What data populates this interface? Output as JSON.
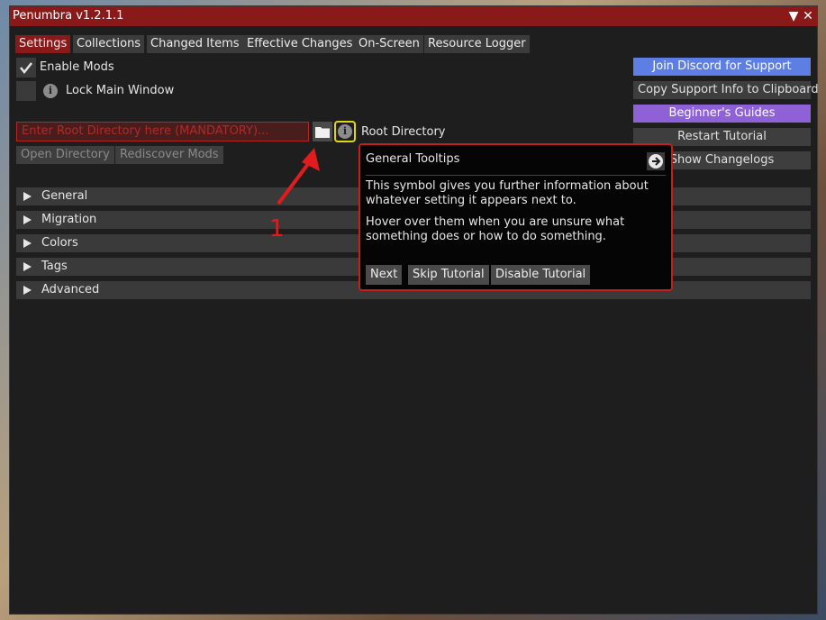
{
  "window": {
    "title": "Penumbra v1.2.1.1",
    "collapse_icon": "triangle-down-icon",
    "close_icon": "close-icon"
  },
  "tabs": [
    {
      "label": "Settings",
      "active": true
    },
    {
      "label": "Collections"
    },
    {
      "label": "Changed Items"
    },
    {
      "label": "Effective Changes"
    },
    {
      "label": "On-Screen"
    },
    {
      "label": "Resource Logger"
    }
  ],
  "settings": {
    "enable_mods": {
      "label": "Enable Mods",
      "checked": true
    },
    "lock_main_window": {
      "label": "Lock Main Window",
      "checked": false
    },
    "root_directory": {
      "placeholder": "Enter Root Directory here (MANDATORY)...",
      "label": "Root Directory"
    },
    "open_directory": "Open Directory",
    "rediscover_mods": "Rediscover Mods"
  },
  "side_buttons": {
    "discord": "Join Discord for Support",
    "copy_support": "Copy Support Info to Clipboard",
    "guides": "Beginner's Guides",
    "restart_tutorial": "Restart Tutorial",
    "changelogs": "Show Changelogs"
  },
  "sections": [
    "General",
    "Migration",
    "Colors",
    "Tags",
    "Advanced"
  ],
  "tooltip": {
    "title": "General Tooltips",
    "paragraph1": "This symbol gives you further information about whatever setting it appears next to.",
    "paragraph2": "Hover over them when you are unsure what something does or how to do something.",
    "next": "Next",
    "skip": "Skip Tutorial",
    "disable": "Disable Tutorial"
  },
  "annotation": {
    "number": "1"
  },
  "colors": {
    "accent": "#8a1a1a",
    "discord": "#5d7ee3",
    "guides": "#8e62d6",
    "tooltip_border": "#c41e1e"
  }
}
